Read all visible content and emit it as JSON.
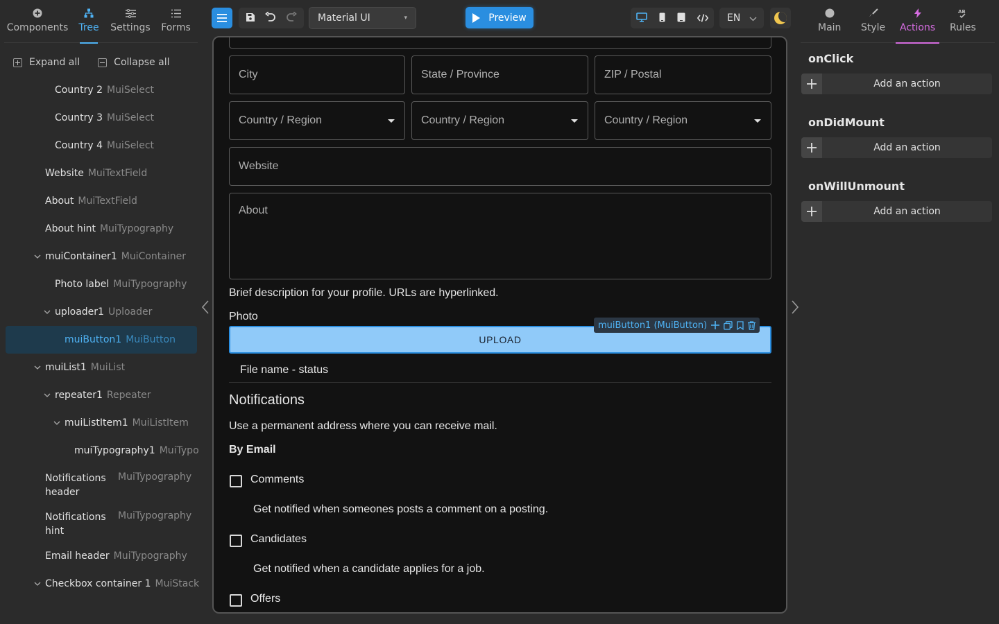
{
  "left_tabs": [
    {
      "label": "Components",
      "icon": "plus-circle-icon"
    },
    {
      "label": "Tree",
      "icon": "tree-icon"
    },
    {
      "label": "Settings",
      "icon": "settings-icon"
    },
    {
      "label": "Forms",
      "icon": "list-icon"
    }
  ],
  "tree_actions": {
    "expand": "Expand all",
    "collapse": "Collapse all"
  },
  "tree": [
    {
      "name": "Country 2",
      "type": "MuiSelect"
    },
    {
      "name": "Country 3",
      "type": "MuiSelect"
    },
    {
      "name": "Country 4",
      "type": "MuiSelect"
    },
    {
      "name": "Website",
      "type": "MuiTextField"
    },
    {
      "name": "About",
      "type": "MuiTextField"
    },
    {
      "name": "About hint",
      "type": "MuiTypography"
    },
    {
      "name": "muiContainer1",
      "type": "MuiContainer"
    },
    {
      "name": "Photo label",
      "type": "MuiTypography"
    },
    {
      "name": "uploader1",
      "type": "Uploader"
    },
    {
      "name": "muiButton1",
      "type": "MuiButton"
    },
    {
      "name": "muiList1",
      "type": "MuiList"
    },
    {
      "name": "repeater1",
      "type": "Repeater"
    },
    {
      "name": "muiListItem1",
      "type": "MuiListItem"
    },
    {
      "name": "muiTypography1",
      "type": "MuiTypo"
    },
    {
      "name": "Notifications header",
      "type": "MuiTypography"
    },
    {
      "name": "Notifications hint",
      "type": "MuiTypography"
    },
    {
      "name": "Email header",
      "type": "MuiTypography"
    },
    {
      "name": "Checkbox container 1",
      "type": "MuiStack"
    }
  ],
  "toolbar": {
    "framework": "Material UI",
    "preview_label": "Preview",
    "language": "EN"
  },
  "form": {
    "city": "City",
    "state": "State / Province",
    "zip": "ZIP / Postal",
    "country1": "Country / Region",
    "country2": "Country / Region",
    "country3": "Country / Region",
    "website": "Website",
    "about": "About",
    "about_hint": "Brief description for your profile. URLs are hyperlinked.",
    "photo_label": "Photo",
    "selection_tag": "muiButton1 (MuiButton)",
    "upload_label": "UPLOAD",
    "file_status": "File name - status",
    "notifications_header": "Notifications",
    "notifications_hint": "Use a permanent address where you can receive mail.",
    "email_header": "By Email",
    "checkboxes": [
      {
        "label": "Comments",
        "hint": "Get notified when someones posts a comment on a posting."
      },
      {
        "label": "Candidates",
        "hint": "Get notified when a candidate applies for a job."
      },
      {
        "label": "Offers",
        "hint": ""
      }
    ]
  },
  "right_tabs": [
    {
      "label": "Main",
      "icon": "circle-icon"
    },
    {
      "label": "Style",
      "icon": "brush-icon"
    },
    {
      "label": "Actions",
      "icon": "bolt-icon"
    },
    {
      "label": "Rules",
      "icon": "rules-icon"
    }
  ],
  "events": [
    {
      "name": "onClick",
      "action_label": "Add an action"
    },
    {
      "name": "onDidMount",
      "action_label": "Add an action"
    },
    {
      "name": "onWillUnmount",
      "action_label": "Add an action"
    }
  ],
  "colors": {
    "accent": "#2a8ee0",
    "actions_tab": "#d56ce0",
    "selected_button": "#90caf9"
  }
}
